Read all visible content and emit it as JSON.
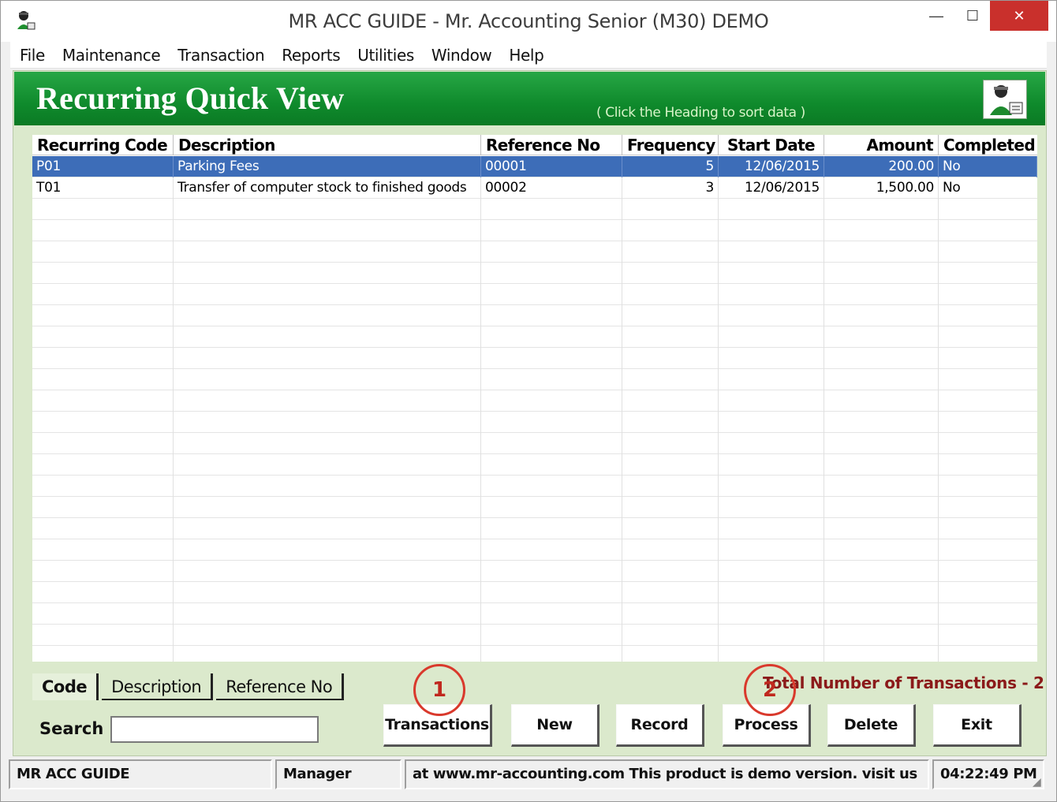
{
  "window": {
    "title": "MR ACC GUIDE - Mr. Accounting Senior (M30) DEMO",
    "controls": {
      "minimize": "—",
      "maximize": "☐",
      "close": "✕"
    }
  },
  "menu": [
    "File",
    "Maintenance",
    "Transaction",
    "Reports",
    "Utilities",
    "Window",
    "Help"
  ],
  "header": {
    "title": "Recurring Quick View",
    "hint": "( Click the Heading to sort data )",
    "logo_icon": "accountant-logo-icon"
  },
  "grid": {
    "columns": [
      "Recurring Code",
      "Description",
      "Reference No",
      "Frequency",
      "Start Date",
      "Amount",
      "Completed"
    ],
    "rows": [
      {
        "code": "P01",
        "description": "Parking Fees",
        "reference": "00001",
        "frequency": "5",
        "start_date": "12/06/2015",
        "amount": "200.00",
        "completed": "No",
        "selected": true
      },
      {
        "code": "T01",
        "description": "Transfer of computer stock to finished goods",
        "reference": "00002",
        "frequency": "3",
        "start_date": "12/06/2015",
        "amount": "1,500.00",
        "completed": "No",
        "selected": false
      }
    ]
  },
  "tabs": [
    "Code",
    "Description",
    "Reference No"
  ],
  "active_tab": "Code",
  "total": "Total Number of Transactions - 2",
  "search": {
    "label": "Search",
    "value": ""
  },
  "buttons": {
    "transactions": "Transactions",
    "new": "New",
    "record": "Record",
    "process": "Process",
    "delete": "Delete",
    "exit": "Exit"
  },
  "callouts": {
    "one": "1",
    "two": "2"
  },
  "status": {
    "app": "MR ACC GUIDE",
    "user": "Manager",
    "message": "at www.mr-accounting.com This product is demo version.  visit us",
    "time": "04:22:49 PM"
  },
  "colors": {
    "header_green": "#0f8a2c",
    "selected_row": "#3d6db8",
    "client_bg": "#dbe9cc",
    "total_text": "#8b1a1a",
    "callout_red": "#d9392c"
  }
}
